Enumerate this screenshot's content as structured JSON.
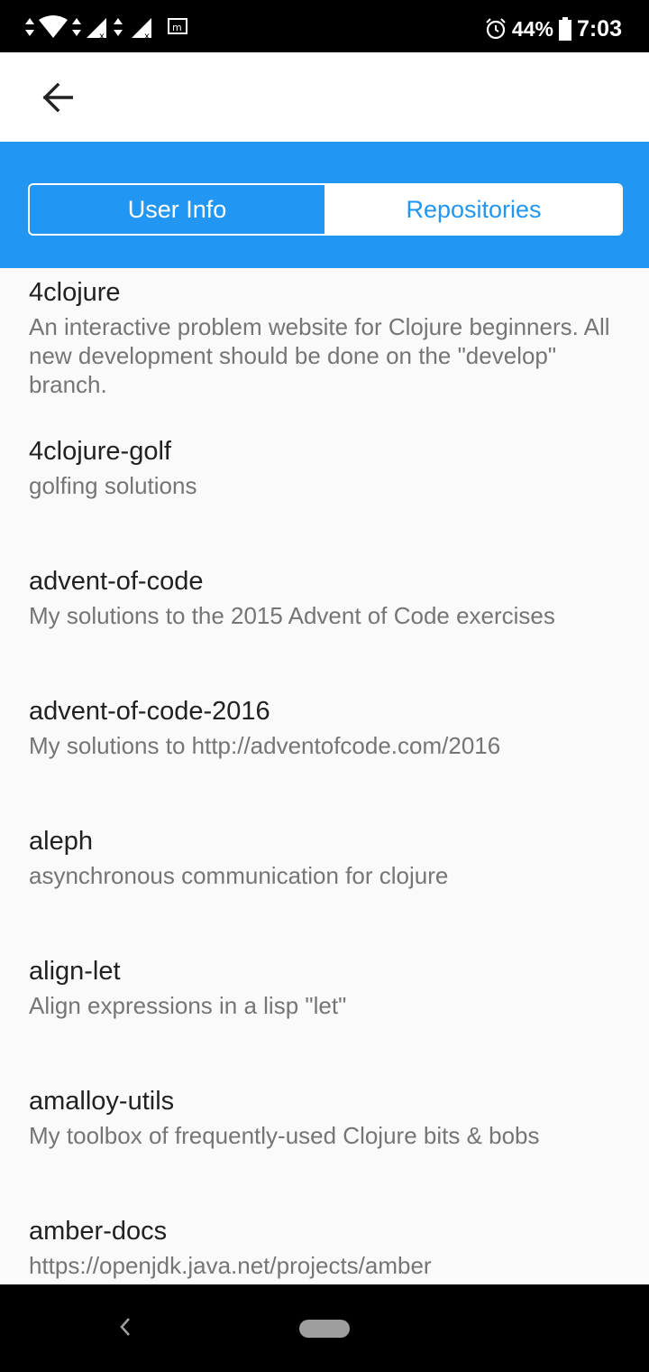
{
  "status_bar": {
    "battery": "44%",
    "time": "7:03"
  },
  "tabs": [
    {
      "label": "User Info",
      "selected": false
    },
    {
      "label": "Repositories",
      "selected": true
    }
  ],
  "repos": [
    {
      "name": "4clojure",
      "description": "An interactive problem website for Clojure beginners.  All new development should be done on the \"develop\" branch."
    },
    {
      "name": "4clojure-golf",
      "description": "golfing solutions"
    },
    {
      "name": "advent-of-code",
      "description": "My solutions to the 2015 Advent of Code exercises"
    },
    {
      "name": "advent-of-code-2016",
      "description": "My solutions to http://adventofcode.com/2016"
    },
    {
      "name": "aleph",
      "description": "asynchronous communication for clojure"
    },
    {
      "name": "align-let",
      "description": "Align expressions in a lisp \"let\""
    },
    {
      "name": "amalloy-utils",
      "description": "My toolbox of frequently-used Clojure bits & bobs"
    },
    {
      "name": "amber-docs",
      "description": "https://openjdk.java.net/projects/amber"
    }
  ],
  "colors": {
    "accent": "#2196f3",
    "title_text": "#212121",
    "secondary_text": "#757575"
  },
  "icons": {
    "back": "arrow-back-icon",
    "status": [
      "data-arrows-icon",
      "wifi-icon",
      "signal-icon",
      "alarm-icon",
      "battery-icon"
    ],
    "nav": [
      "nav-back-icon",
      "home-pill-icon"
    ]
  }
}
